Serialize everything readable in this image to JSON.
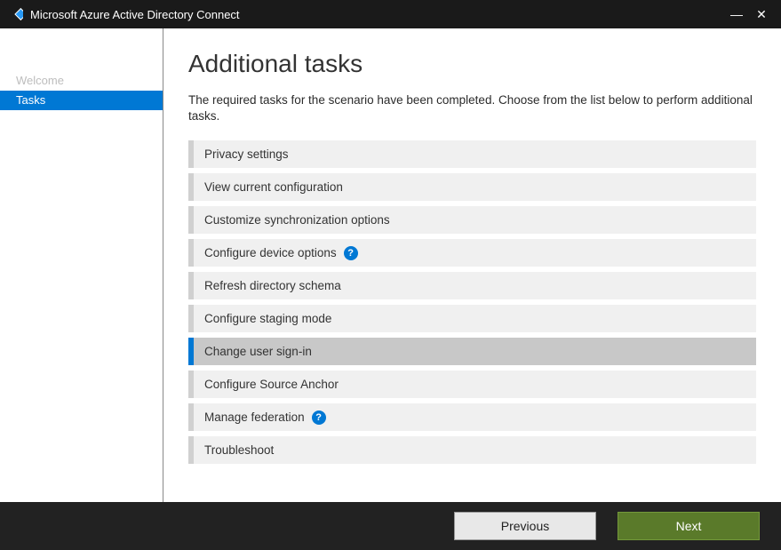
{
  "window": {
    "title": "Microsoft Azure Active Directory Connect"
  },
  "sidebar": {
    "items": [
      {
        "label": "Welcome",
        "active": false
      },
      {
        "label": "Tasks",
        "active": true
      }
    ]
  },
  "main": {
    "title": "Additional tasks",
    "intro": "The required tasks for the scenario have been completed. Choose from the list below to perform additional tasks.",
    "tasks": [
      {
        "label": "Privacy settings",
        "help": false,
        "selected": false
      },
      {
        "label": "View current configuration",
        "help": false,
        "selected": false
      },
      {
        "label": "Customize synchronization options",
        "help": false,
        "selected": false
      },
      {
        "label": "Configure device options",
        "help": true,
        "selected": false
      },
      {
        "label": "Refresh directory schema",
        "help": false,
        "selected": false
      },
      {
        "label": "Configure staging mode",
        "help": false,
        "selected": false
      },
      {
        "label": "Change user sign-in",
        "help": false,
        "selected": true
      },
      {
        "label": "Configure Source Anchor",
        "help": false,
        "selected": false
      },
      {
        "label": "Manage federation",
        "help": true,
        "selected": false
      },
      {
        "label": "Troubleshoot",
        "help": false,
        "selected": false
      }
    ]
  },
  "footer": {
    "previous_label": "Previous",
    "next_label": "Next"
  }
}
